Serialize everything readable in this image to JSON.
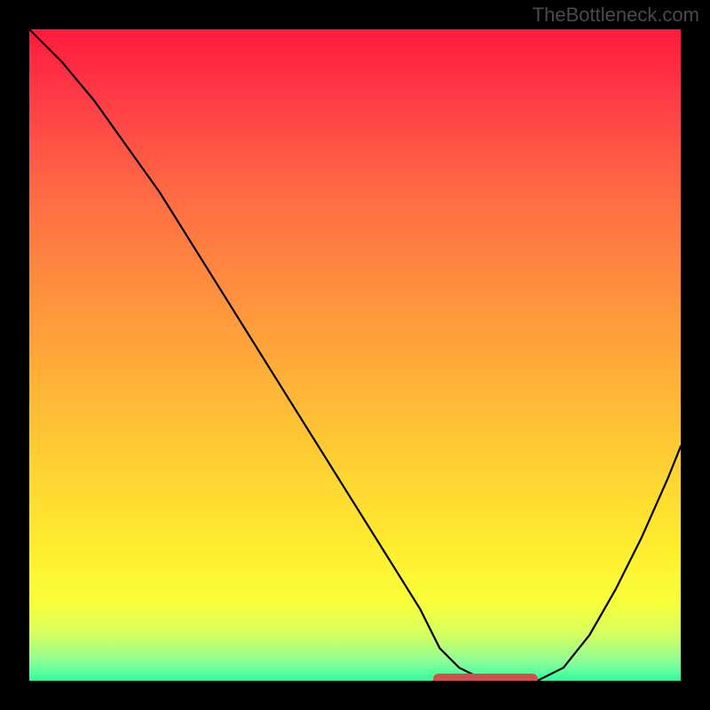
{
  "watermark": "TheBottleneck.com",
  "chart_data": {
    "type": "line",
    "title": "",
    "xlabel": "",
    "ylabel": "",
    "xlim": [
      0,
      100
    ],
    "ylim": [
      0,
      100
    ],
    "series": [
      {
        "name": "bottleneck-curve",
        "x": [
          0,
          5,
          10,
          15,
          20,
          25,
          30,
          35,
          40,
          45,
          50,
          55,
          60,
          63,
          66,
          70,
          74,
          78,
          82,
          86,
          90,
          94,
          98,
          100
        ],
        "y": [
          100,
          95,
          89,
          82,
          75,
          67,
          59,
          51,
          43,
          35,
          27,
          19,
          11,
          5,
          2,
          0,
          0,
          0,
          2,
          7,
          14,
          22,
          31,
          36
        ]
      }
    ],
    "highlight": {
      "name": "optimal-range",
      "x_start": 62,
      "x_end": 78,
      "y": 0
    },
    "background": {
      "type": "vertical-gradient",
      "top_color": "#ff1a3e",
      "bottom_color": "#2fff9f",
      "meaning": "red=high bottleneck, green=low bottleneck"
    }
  }
}
